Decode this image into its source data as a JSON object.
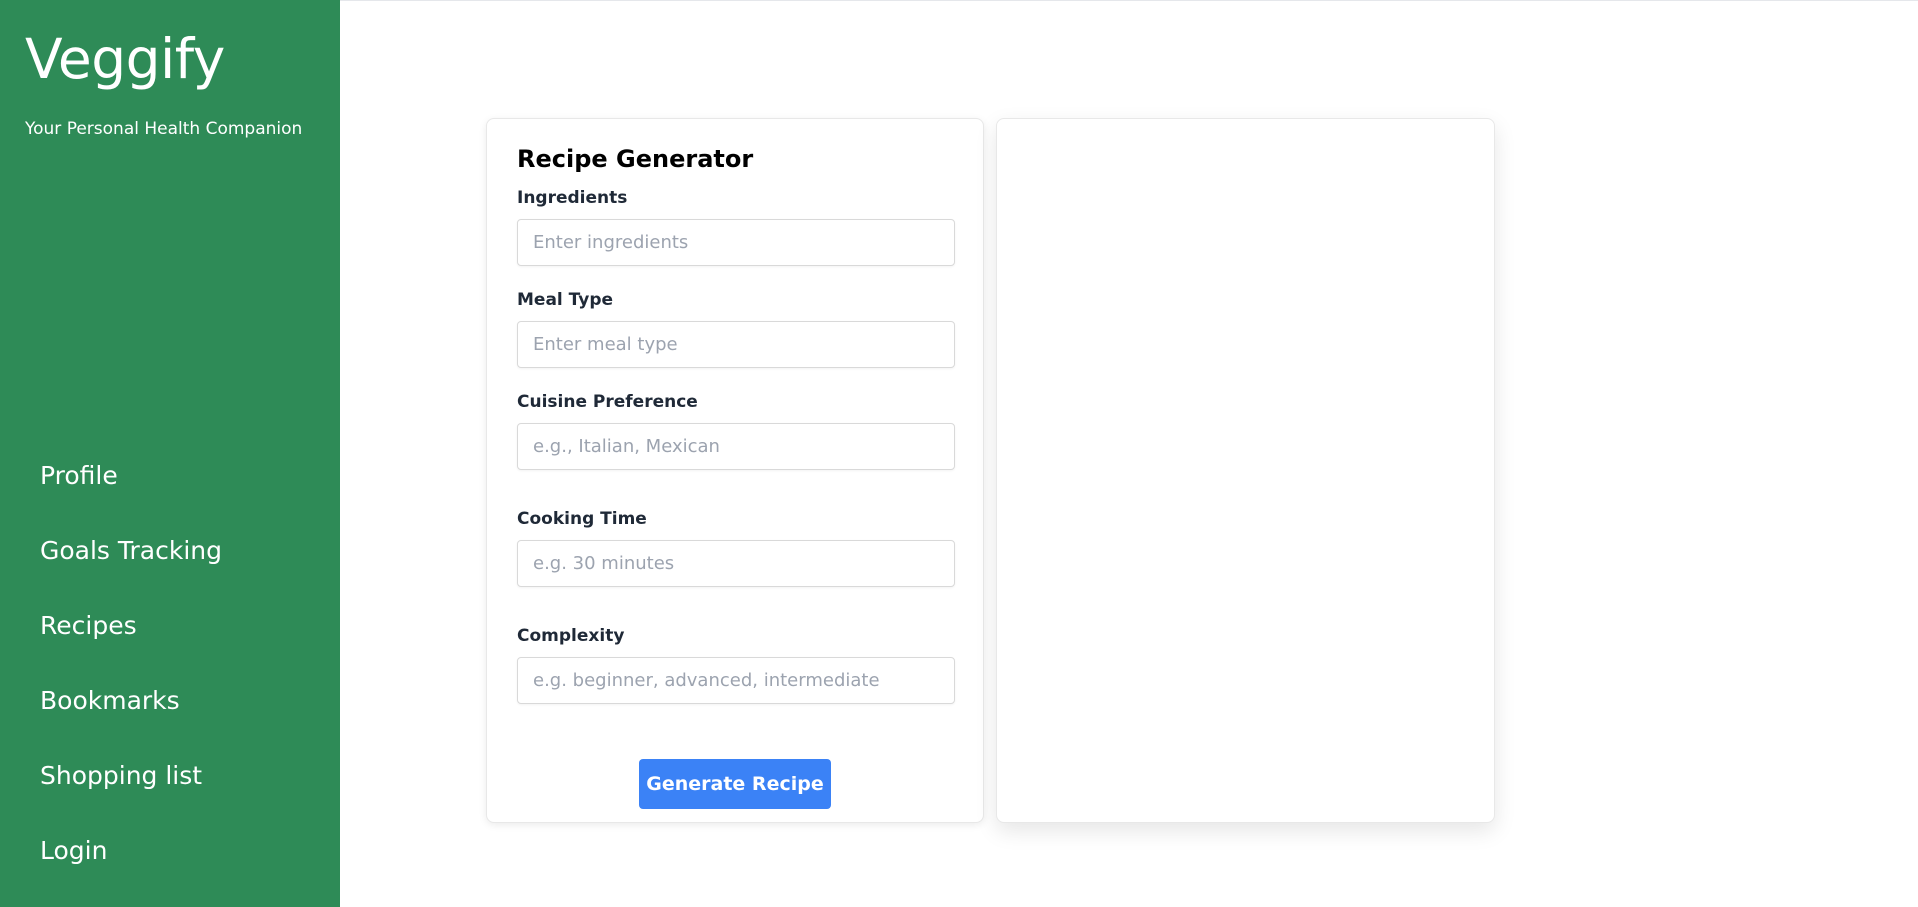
{
  "app": {
    "brand": "Veggify",
    "tagline": "Your Personal Health Companion"
  },
  "sidebar": {
    "items": [
      {
        "label": "Profile"
      },
      {
        "label": "Goals Tracking"
      },
      {
        "label": "Recipes"
      },
      {
        "label": "Bookmarks"
      },
      {
        "label": "Shopping list"
      },
      {
        "label": "Login"
      }
    ]
  },
  "form": {
    "title": "Recipe Generator",
    "fields": [
      {
        "label": "Ingredients",
        "value": "",
        "placeholder": "Enter ingredients"
      },
      {
        "label": "Meal Type",
        "value": "",
        "placeholder": "Enter meal type"
      },
      {
        "label": "Cuisine Preference",
        "value": "",
        "placeholder": "e.g., Italian, Mexican"
      },
      {
        "label": "Cooking Time",
        "value": "",
        "placeholder": "e.g. 30 minutes"
      },
      {
        "label": "Complexity",
        "value": "",
        "placeholder": "e.g. beginner, advanced, intermediate"
      }
    ],
    "submit_label": "Generate Recipe"
  },
  "colors": {
    "sidebar_bg": "#2e8b57",
    "button_bg": "#3b82f6"
  }
}
